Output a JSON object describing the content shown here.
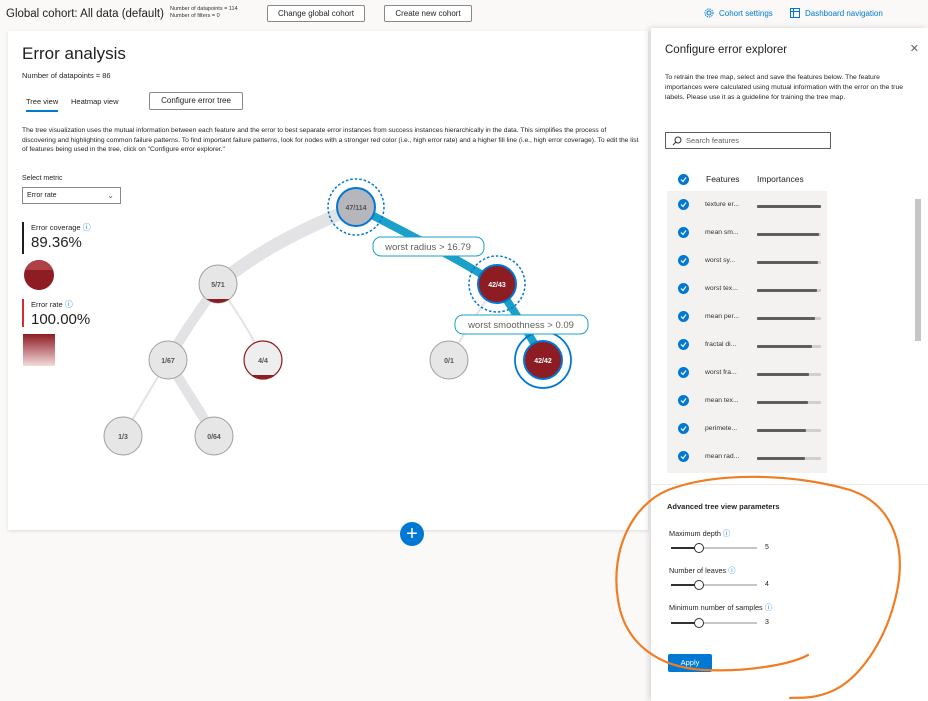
{
  "topbar": {
    "cohort_title": "Global cohort: All data (default)",
    "datapoints": "Number of datapoints = 114",
    "filters": "Number of filters = 0",
    "change_cohort": "Change global cohort",
    "create_cohort": "Create new cohort",
    "cohort_settings": "Cohort settings",
    "dashboard_nav": "Dashboard navigation",
    "icons": [
      "gear-icon",
      "grid-icon"
    ]
  },
  "main": {
    "title": "Error analysis",
    "count": "Number of datapoints = 86",
    "tabs": [
      {
        "label": "Tree view",
        "active": true
      },
      {
        "label": "Heatmap view",
        "active": false
      }
    ],
    "configure_btn": "Configure error tree",
    "description": "The tree visualization uses the mutual information between each feature and the error to best separate error instances from success instances hierarchically in the data. This simplifies the process of discovering and highlighting common failure patterns. To find important failure patterns, look for nodes with a stronger red color (i.e., high error rate) and a higher fill line (i.e., high error coverage). To edit the list of features being used in the tree, click on \"Configure error explorer.\"",
    "select_label": "Select metric",
    "select_value": "Error rate",
    "error_coverage_label": "Error coverage",
    "error_coverage_value": "89.36%",
    "error_rate_label": "Error rate",
    "error_rate_value": "100.00%"
  },
  "tree": {
    "nodes": [
      {
        "label": "47/114",
        "error_ratio": 0.41,
        "selected": true
      },
      {
        "label": "5/71",
        "error_ratio": 0.07,
        "selected": false
      },
      {
        "label": "42/43",
        "error_ratio": 0.98,
        "selected": true
      },
      {
        "label": "1/67",
        "error_ratio": 0.01,
        "selected": false
      },
      {
        "label": "4/4",
        "error_ratio": 1.0,
        "selected": false
      },
      {
        "label": "0/1",
        "error_ratio": 0.0,
        "selected": false
      },
      {
        "label": "42/42",
        "error_ratio": 1.0,
        "selected": true
      },
      {
        "label": "1/3",
        "error_ratio": 0.33,
        "selected": false
      },
      {
        "label": "0/64",
        "error_ratio": 0.0,
        "selected": false
      }
    ],
    "split_labels": [
      "worst radius > 16.79",
      "worst smoothness > 0.09"
    ]
  },
  "panel": {
    "title": "Configure error explorer",
    "description": "To retrain the tree map, select and save the features below. The feature importances were calculated using mutual information with the error on the true labels. Please use it as a guideline for training the tree map.",
    "search_placeholder": "Search features",
    "col_features": "Features",
    "col_importances": "Importances",
    "features": [
      {
        "name": "texture er...",
        "importance": 1.0
      },
      {
        "name": "mean sm...",
        "importance": 0.97
      },
      {
        "name": "worst sy...",
        "importance": 0.95
      },
      {
        "name": "worst tex...",
        "importance": 0.93
      },
      {
        "name": "mean per...",
        "importance": 0.9
      },
      {
        "name": "fractal di...",
        "importance": 0.86
      },
      {
        "name": "worst fra...",
        "importance": 0.82
      },
      {
        "name": "mean tex...",
        "importance": 0.8
      },
      {
        "name": "perimete...",
        "importance": 0.77
      },
      {
        "name": "mean rad...",
        "importance": 0.75
      }
    ],
    "advanced_title": "Advanced tree view parameters",
    "sliders": [
      {
        "label": "Maximum depth",
        "value": "5",
        "fraction": 0.33
      },
      {
        "label": "Number of leaves",
        "value": "4",
        "fraction": 0.33
      },
      {
        "label": "Minimum number of samples",
        "value": "3",
        "fraction": 0.33
      }
    ],
    "apply": "Apply"
  },
  "colors": {
    "accent": "#0078d4",
    "error": "#8e1c23",
    "node_gray": "#e6e6e6"
  }
}
